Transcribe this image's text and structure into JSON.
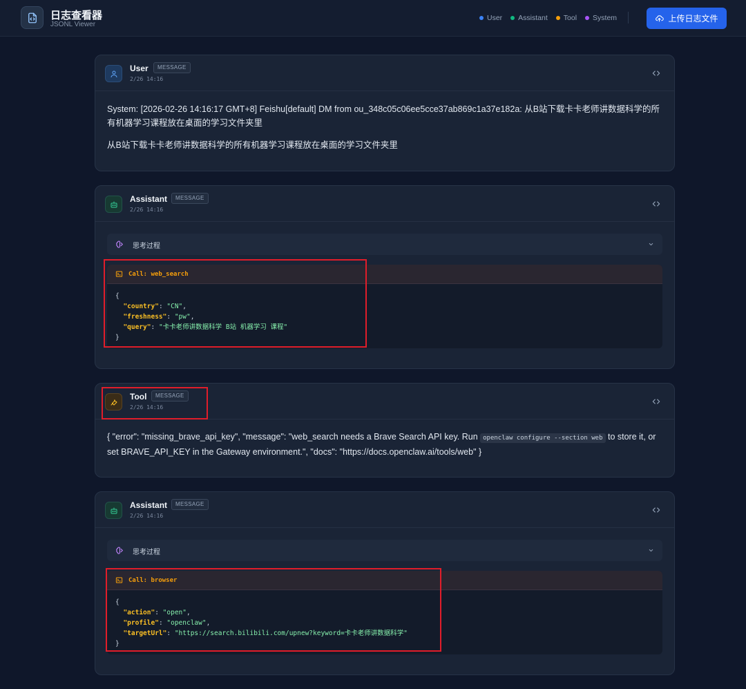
{
  "app": {
    "title": "日志查看器",
    "subtitle": "JSONL Viewer",
    "upload_label": "上传日志文件"
  },
  "legend": [
    {
      "label": "User",
      "color": "#3b82f6"
    },
    {
      "label": "Assistant",
      "color": "#10b981"
    },
    {
      "label": "Tool",
      "color": "#f59e0b"
    },
    {
      "label": "System",
      "color": "#a855f7"
    }
  ],
  "messages": [
    {
      "role": "User",
      "badge": "MESSAGE",
      "time": "2/26 14:16",
      "paragraphs": [
        "System: [2026-02-26 14:16:17 GMT+8] Feishu[default] DM from ou_348c05c06ee5cce37ab869c1a37e182a: 从B站下载卡卡老师讲数据科学的所有机器学习课程放在桌面的学习文件夹里",
        "从B站下载卡卡老师讲数据科学的所有机器学习课程放在桌面的学习文件夹里"
      ]
    },
    {
      "role": "Assistant",
      "badge": "MESSAGE",
      "time": "2/26 14:16",
      "thinking_label": "思考过程",
      "call": {
        "label": "Call: web_search",
        "open": "{",
        "close": "}",
        "args": [
          {
            "key": "\"country\"",
            "value": "\"CN\"",
            "sep": ","
          },
          {
            "key": "\"freshness\"",
            "value": "\"pw\"",
            "sep": ","
          },
          {
            "key": "\"query\"",
            "value": "\"卡卡老师讲数据科学 B站 机器学习 课程\"",
            "sep": ""
          }
        ]
      }
    },
    {
      "role": "Tool",
      "badge": "MESSAGE",
      "time": "2/26 14:16",
      "text_before": "{ \"error\": \"missing_brave_api_key\", \"message\": \"web_search needs a Brave Search API key. Run ",
      "code": "openclaw configure --section web",
      "text_after": " to store it, or set BRAVE_API_KEY in the Gateway environment.\", \"docs\": \"https://docs.openclaw.ai/tools/web\" }"
    },
    {
      "role": "Assistant",
      "badge": "MESSAGE",
      "time": "2/26 14:16",
      "thinking_label": "思考过程",
      "call": {
        "label": "Call: browser",
        "open": "{",
        "close": "}",
        "args": [
          {
            "key": "\"action\"",
            "value": "\"open\"",
            "sep": ","
          },
          {
            "key": "\"profile\"",
            "value": "\"openclaw\"",
            "sep": ","
          },
          {
            "key": "\"targetUrl\"",
            "value": "\"https://search.bilibili.com/upnew?keyword=卡卡老师讲数据科学\"",
            "sep": ""
          }
        ]
      }
    }
  ]
}
